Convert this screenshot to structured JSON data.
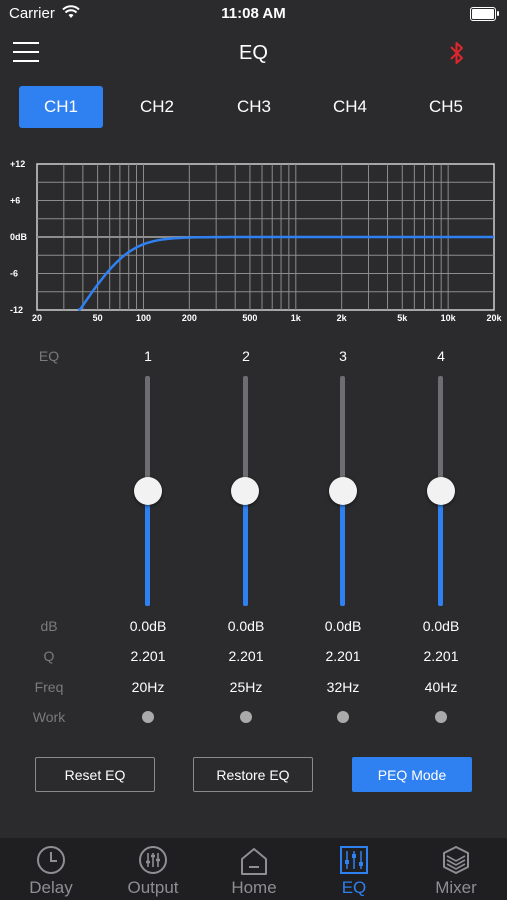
{
  "status": {
    "carrier": "Carrier",
    "time": "11:08 AM"
  },
  "nav": {
    "title": "EQ",
    "menu_icon": "hamburger-icon",
    "bluetooth_icon": "bluetooth-icon",
    "bluetooth_color": "#e0262a"
  },
  "channels": [
    "CH1",
    "CH2",
    "CH3",
    "CH4",
    "CH5"
  ],
  "active_channel": "CH1",
  "graph": {
    "y_labels": [
      "+12",
      "+6",
      "0dB",
      "-6",
      "-12"
    ],
    "x_labels": [
      "20",
      "50",
      "100",
      "200",
      "500",
      "1k",
      "2k",
      "5k",
      "10k",
      "20k"
    ],
    "curve_color": "#2f80f0"
  },
  "eq": {
    "header_label": "EQ",
    "bands": [
      {
        "num": "1",
        "db": "0.0dB",
        "q": "2.201",
        "freq": "20Hz",
        "level": 0.5
      },
      {
        "num": "2",
        "db": "0.0dB",
        "q": "2.201",
        "freq": "25Hz",
        "level": 0.5
      },
      {
        "num": "3",
        "db": "0.0dB",
        "q": "2.201",
        "freq": "32Hz",
        "level": 0.5
      },
      {
        "num": "4",
        "db": "0.0dB",
        "q": "2.201",
        "freq": "40Hz",
        "level": 0.5
      }
    ],
    "row_labels": {
      "db": "dB",
      "q": "Q",
      "freq": "Freq",
      "work": "Work"
    }
  },
  "buttons": {
    "reset": "Reset EQ",
    "restore": "Restore EQ",
    "peq": "PEQ Mode"
  },
  "tabbar": [
    {
      "label": "Delay",
      "icon": "clock-icon"
    },
    {
      "label": "Output",
      "icon": "sliders-icon"
    },
    {
      "label": "Home",
      "icon": "home-icon"
    },
    {
      "label": "EQ",
      "icon": "eq-icon",
      "active": true
    },
    {
      "label": "Mixer",
      "icon": "layers-icon"
    }
  ],
  "accent": "#2f80f0"
}
